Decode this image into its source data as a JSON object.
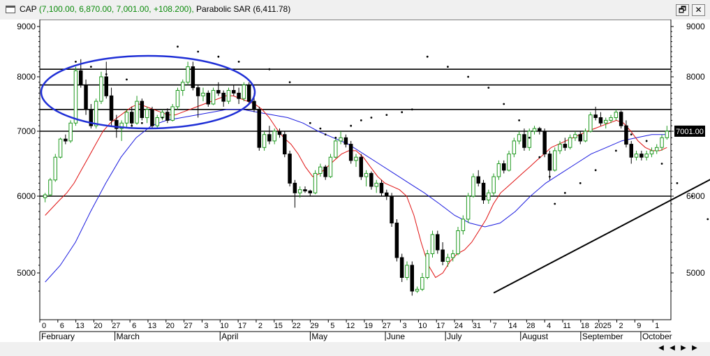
{
  "window": {
    "symbol_label": "CAP",
    "ohlc_text": "(7,100.00, 6,870.00, 7,001.00, +108.200),",
    "indicator_label": "Parabolic SAR (6,411.78)",
    "restore_glyph": "🗗",
    "close_glyph": "✕"
  },
  "chart_data": {
    "type": "candlestick",
    "ylim": [
      4700,
      9200
    ],
    "y_ticks": [
      5000,
      6000,
      7000,
      8000,
      9000
    ],
    "y_tick_labels": [
      "5000",
      "6000",
      "7000",
      "8000",
      "9000"
    ],
    "last_price_label": "7001.00",
    "last_price": 7001,
    "day_labels": [
      "0",
      "6",
      "13",
      "20",
      "27",
      "6",
      "13",
      "20",
      "27",
      "3",
      "10",
      "17",
      "2",
      "15",
      "22",
      "29",
      "5",
      "12",
      "19",
      "27",
      "3",
      "10",
      "17",
      "24",
      "31",
      "7",
      "14",
      "28",
      "4",
      "11",
      "18",
      "2025",
      "2",
      "9",
      "1"
    ],
    "month_labels": [
      "February",
      "March",
      "April",
      "May",
      "June",
      "July",
      "August",
      "September",
      "October"
    ],
    "horizontal_levels": [
      8150,
      7850,
      7400,
      7000,
      6000
    ],
    "trendline": {
      "from_bar": 88,
      "to_bar": 160,
      "from_price": 4780,
      "to_price": 7560
    },
    "candles": [
      [
        5980,
        6050,
        5920,
        6020
      ],
      [
        6020,
        6280,
        6000,
        6250
      ],
      [
        6250,
        6650,
        6220,
        6600
      ],
      [
        6600,
        6900,
        6580,
        6880
      ],
      [
        6880,
        6950,
        6800,
        6850
      ],
      [
        6850,
        7200,
        6820,
        7150
      ],
      [
        7150,
        8200,
        7100,
        8120
      ],
      [
        8120,
        8350,
        7800,
        7850
      ],
      [
        7850,
        7950,
        7300,
        7400
      ],
      [
        7400,
        7500,
        7050,
        7100
      ],
      [
        7100,
        7600,
        7050,
        7550
      ],
      [
        7550,
        8100,
        7500,
        8000
      ],
      [
        8000,
        8300,
        7600,
        7650
      ],
      [
        7650,
        7800,
        7100,
        7200
      ],
      [
        7200,
        7300,
        6900,
        7050
      ],
      [
        7050,
        7200,
        6850,
        7150
      ],
      [
        7150,
        7400,
        7080,
        7350
      ],
      [
        7350,
        7450,
        7100,
        7150
      ],
      [
        7150,
        7650,
        7120,
        7550
      ],
      [
        7550,
        7600,
        7200,
        7250
      ],
      [
        7250,
        7450,
        7150,
        7400
      ],
      [
        7400,
        7450,
        7050,
        7100
      ],
      [
        7100,
        7300,
        7050,
        7250
      ],
      [
        7250,
        7400,
        7200,
        7350
      ],
      [
        7350,
        7420,
        7150,
        7200
      ],
      [
        7200,
        7500,
        7180,
        7450
      ],
      [
        7450,
        7800,
        7400,
        7750
      ],
      [
        7750,
        7950,
        7650,
        7900
      ],
      [
        7900,
        8300,
        7850,
        8200
      ],
      [
        8200,
        8300,
        7750,
        7800
      ],
      [
        7800,
        7850,
        7250,
        7650
      ],
      [
        7650,
        7800,
        7550,
        7700
      ],
      [
        7700,
        7750,
        7450,
        7500
      ],
      [
        7500,
        7800,
        7480,
        7750
      ],
      [
        7750,
        7900,
        7650,
        7700
      ],
      [
        7700,
        7750,
        7450,
        7550
      ],
      [
        7550,
        7800,
        7500,
        7750
      ],
      [
        7750,
        7850,
        7650,
        7700
      ],
      [
        7700,
        7800,
        7500,
        7600
      ],
      [
        7600,
        7900,
        7550,
        7850
      ],
      [
        7850,
        7900,
        7500,
        7550
      ],
      [
        7550,
        7700,
        7350,
        7400
      ],
      [
        7400,
        7450,
        6700,
        6750
      ],
      [
        6750,
        7000,
        6700,
        6950
      ],
      [
        6950,
        7100,
        6800,
        6850
      ],
      [
        6850,
        7050,
        6800,
        7000
      ],
      [
        7000,
        7050,
        6900,
        6950
      ],
      [
        6950,
        7000,
        6600,
        6650
      ],
      [
        6650,
        6700,
        6150,
        6200
      ],
      [
        6200,
        6250,
        5850,
        6050
      ],
      [
        6050,
        6150,
        5980,
        6100
      ],
      [
        6100,
        6150,
        6050,
        6080
      ],
      [
        6080,
        6100,
        6000,
        6050
      ],
      [
        6050,
        6400,
        6030,
        6350
      ],
      [
        6350,
        6500,
        6300,
        6450
      ],
      [
        6450,
        6480,
        6250,
        6300
      ],
      [
        6300,
        6650,
        6280,
        6600
      ],
      [
        6600,
        6900,
        6580,
        6850
      ],
      [
        6850,
        7000,
        6800,
        6900
      ],
      [
        6900,
        6950,
        6750,
        6800
      ],
      [
        6800,
        6850,
        6500,
        6550
      ],
      [
        6550,
        6650,
        6450,
        6600
      ],
      [
        6600,
        6650,
        6250,
        6300
      ],
      [
        6300,
        6400,
        6150,
        6350
      ],
      [
        6350,
        6380,
        6100,
        6150
      ],
      [
        6150,
        6250,
        6050,
        6200
      ],
      [
        6200,
        6250,
        6000,
        6050
      ],
      [
        6050,
        6100,
        5950,
        6000
      ],
      [
        6000,
        6050,
        5600,
        5650
      ],
      [
        5650,
        5700,
        5150,
        5200
      ],
      [
        5200,
        5250,
        4900,
        4950
      ],
      [
        4950,
        5150,
        4920,
        5100
      ],
      [
        5100,
        5150,
        4750,
        4800
      ],
      [
        4800,
        4850,
        4780,
        4820
      ],
      [
        4820,
        5000,
        4800,
        4950
      ],
      [
        4950,
        5300,
        4930,
        5250
      ],
      [
        5250,
        5550,
        5200,
        5500
      ],
      [
        5500,
        5550,
        5250,
        5300
      ],
      [
        5300,
        5400,
        5100,
        5150
      ],
      [
        5150,
        5250,
        5080,
        5200
      ],
      [
        5200,
        5300,
        5150,
        5250
      ],
      [
        5250,
        5600,
        5230,
        5550
      ],
      [
        5550,
        5750,
        5500,
        5700
      ],
      [
        5700,
        6050,
        5650,
        6000
      ],
      [
        6000,
        6350,
        5980,
        6300
      ],
      [
        6300,
        6400,
        6150,
        6200
      ],
      [
        6200,
        6250,
        5900,
        5950
      ],
      [
        5950,
        6100,
        5900,
        6050
      ],
      [
        6050,
        6350,
        6000,
        6300
      ],
      [
        6300,
        6550,
        6250,
        6500
      ],
      [
        6500,
        6550,
        6350,
        6400
      ],
      [
        6400,
        6700,
        6380,
        6650
      ],
      [
        6650,
        6900,
        6600,
        6850
      ],
      [
        6850,
        7000,
        6800,
        6950
      ],
      [
        6950,
        7050,
        6700,
        6750
      ],
      [
        6750,
        7050,
        6700,
        7000
      ],
      [
        7000,
        7100,
        6950,
        7050
      ],
      [
        7050,
        7080,
        6950,
        7000
      ],
      [
        7000,
        7050,
        6600,
        6650
      ],
      [
        6650,
        6700,
        6250,
        6400
      ],
      [
        6400,
        6750,
        6380,
        6700
      ],
      [
        6700,
        6850,
        6650,
        6800
      ],
      [
        6800,
        6900,
        6700,
        6750
      ],
      [
        6750,
        6950,
        6720,
        6900
      ],
      [
        6900,
        7000,
        6850,
        6950
      ],
      [
        6950,
        7000,
        6800,
        6850
      ],
      [
        6850,
        7050,
        6830,
        7000
      ],
      [
        7000,
        7350,
        6980,
        7300
      ],
      [
        7300,
        7450,
        7200,
        7250
      ],
      [
        7250,
        7350,
        7100,
        7150
      ],
      [
        7150,
        7250,
        7050,
        7200
      ],
      [
        7200,
        7300,
        7150,
        7250
      ],
      [
        7250,
        7400,
        7200,
        7350
      ],
      [
        7350,
        7380,
        7050,
        7100
      ],
      [
        7100,
        7200,
        6750,
        6800
      ],
      [
        6800,
        6850,
        6500,
        6600
      ],
      [
        6600,
        6700,
        6550,
        6650
      ],
      [
        6650,
        6700,
        6550,
        6600
      ],
      [
        6600,
        6700,
        6550,
        6650
      ],
      [
        6650,
        6750,
        6600,
        6700
      ],
      [
        6700,
        6800,
        6650,
        6750
      ],
      [
        6750,
        6950,
        6700,
        6900
      ],
      [
        6900,
        7100,
        6870,
        7001
      ]
    ],
    "ma_red": [
      5750,
      5850,
      5950,
      6050,
      6200,
      6400,
      6600,
      6800,
      7000,
      7150,
      7250,
      7350,
      7450,
      7500,
      7450,
      7400,
      7350,
      7300,
      7300,
      7350,
      7400,
      7450,
      7500,
      7550,
      7600,
      7650,
      7650,
      7600,
      7550,
      7500,
      7400,
      7250,
      7050,
      6900,
      6800,
      6650,
      6450,
      6300,
      6350,
      6450,
      6550,
      6650,
      6700,
      6700,
      6600,
      6450,
      6300,
      6200,
      6150,
      6100,
      6000,
      5750,
      5400,
      5100,
      4950,
      5000,
      5150,
      5250,
      5300,
      5400,
      5550,
      5700,
      5900,
      6050,
      6150,
      6250,
      6350,
      6450,
      6550,
      6650,
      6750,
      6800,
      6850,
      6900,
      6950,
      7000,
      7050,
      7100,
      7150,
      7200,
      7150,
      7000,
      6850,
      6750,
      6700,
      6700,
      6750
    ],
    "ma_blue": [
      4900,
      5100,
      5400,
      5800,
      6200,
      6600,
      6900,
      7100,
      7200,
      7250,
      7300,
      7350,
      7400,
      7400,
      7350,
      7300,
      7250,
      7150,
      7000,
      6900,
      6800,
      6650,
      6500,
      6350,
      6200,
      6050,
      5900,
      5750,
      5650,
      5600,
      5650,
      5800,
      6000,
      6200,
      6350,
      6500,
      6650,
      6750,
      6850,
      6900,
      6950,
      6950
    ],
    "sar_points": [
      [
        6,
        8300
      ],
      [
        9,
        8200
      ],
      [
        12,
        8050
      ],
      [
        16,
        7950
      ],
      [
        17,
        7100
      ],
      [
        19,
        7150
      ],
      [
        21,
        7200
      ],
      [
        23,
        7250
      ],
      [
        26,
        8600
      ],
      [
        30,
        8500
      ],
      [
        34,
        8400
      ],
      [
        38,
        8300
      ],
      [
        44,
        8150
      ],
      [
        48,
        7900
      ],
      [
        52,
        7150
      ],
      [
        54,
        7050
      ],
      [
        55,
        6950
      ],
      [
        57,
        6900
      ],
      [
        60,
        7100
      ],
      [
        62,
        7200
      ],
      [
        64,
        7250
      ],
      [
        67,
        7300
      ],
      [
        70,
        7350
      ],
      [
        72,
        7400
      ],
      [
        75,
        8400
      ],
      [
        79,
        8200
      ],
      [
        83,
        8000
      ],
      [
        87,
        7800
      ],
      [
        90,
        7500
      ],
      [
        93,
        7200
      ],
      [
        95,
        6900
      ],
      [
        97,
        6600
      ],
      [
        99,
        6300
      ],
      [
        100,
        5900
      ],
      [
        102,
        6050
      ],
      [
        105,
        6200
      ],
      [
        108,
        6400
      ],
      [
        112,
        6700
      ],
      [
        115,
        6950
      ],
      [
        118,
        6850
      ],
      [
        121,
        6500
      ],
      [
        124,
        6200
      ],
      [
        127,
        6000
      ],
      [
        130,
        5700
      ],
      [
        133,
        5450
      ],
      [
        136,
        5200
      ],
      [
        140,
        4900
      ],
      [
        143,
        4800
      ],
      [
        146,
        5000
      ],
      [
        149,
        5200
      ],
      [
        152,
        5400
      ],
      [
        155,
        5600
      ],
      [
        157,
        5800
      ],
      [
        159,
        5950
      ],
      [
        161,
        6100
      ],
      [
        163,
        6250
      ],
      [
        165,
        6350
      ],
      [
        168,
        6600
      ],
      [
        171,
        6800
      ],
      [
        174,
        7050
      ],
      [
        177,
        7100
      ],
      [
        180,
        7000
      ],
      [
        183,
        6900
      ],
      [
        186,
        6950
      ],
      [
        189,
        7200
      ],
      [
        192,
        7300
      ],
      [
        195,
        7400
      ],
      [
        198,
        7480
      ],
      [
        201,
        7520
      ],
      [
        204,
        7450
      ],
      [
        207,
        7300
      ],
      [
        210,
        7150
      ],
      [
        213,
        6900
      ],
      [
        215,
        6400
      ]
    ]
  }
}
